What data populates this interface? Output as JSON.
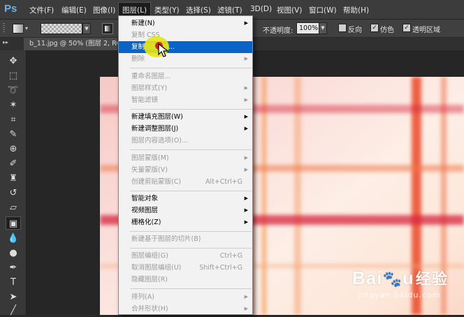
{
  "app": {
    "logo": "Ps"
  },
  "menubar": [
    {
      "label": "文件(F)"
    },
    {
      "label": "编辑(E)"
    },
    {
      "label": "图像(I)"
    },
    {
      "label": "图层(L)"
    },
    {
      "label": "类型(Y)"
    },
    {
      "label": "选择(S)"
    },
    {
      "label": "滤镜(T)"
    },
    {
      "label": "3D(D)"
    },
    {
      "label": "视图(V)"
    },
    {
      "label": "窗口(W)"
    },
    {
      "label": "帮助(H)"
    }
  ],
  "options": {
    "opacity_label": "不透明度:",
    "opacity_value": "100%",
    "reverse_label": "反向",
    "dither_label": "仿色",
    "transparency_label": "透明区域",
    "check_mark": "✓"
  },
  "document": {
    "tab_title": "b_11.jpg @ 50% (图层 2, RGB/8)"
  },
  "layer_menu": {
    "items": [
      {
        "label": "新建(N)",
        "shortcut": "",
        "submenu": true,
        "enabled": true,
        "highlighted": false
      },
      {
        "label": "复制 CSS",
        "shortcut": "",
        "submenu": false,
        "enabled": false,
        "highlighted": false
      },
      {
        "label": "复制图层(D)...",
        "shortcut": "",
        "submenu": false,
        "enabled": true,
        "highlighted": true
      },
      {
        "label": "删除",
        "shortcut": "",
        "submenu": true,
        "enabled": false,
        "highlighted": false
      },
      {
        "label": "重命名图层...",
        "shortcut": "",
        "submenu": false,
        "enabled": false,
        "highlighted": false
      },
      {
        "label": "图层样式(Y)",
        "shortcut": "",
        "submenu": true,
        "enabled": false,
        "highlighted": false
      },
      {
        "label": "智能滤镜",
        "shortcut": "",
        "submenu": true,
        "enabled": false,
        "highlighted": false
      },
      {
        "label": "新建填充图层(W)",
        "shortcut": "",
        "submenu": true,
        "enabled": true,
        "highlighted": false
      },
      {
        "label": "新建调整图层(J)",
        "shortcut": "",
        "submenu": true,
        "enabled": true,
        "highlighted": false
      },
      {
        "label": "图层内容选项(O)...",
        "shortcut": "",
        "submenu": false,
        "enabled": false,
        "highlighted": false
      },
      {
        "label": "图层蒙版(M)",
        "shortcut": "",
        "submenu": true,
        "enabled": false,
        "highlighted": false
      },
      {
        "label": "矢量蒙版(V)",
        "shortcut": "",
        "submenu": true,
        "enabled": false,
        "highlighted": false
      },
      {
        "label": "创建剪贴蒙版(C)",
        "shortcut": "Alt+Ctrl+G",
        "submenu": false,
        "enabled": false,
        "highlighted": false
      },
      {
        "label": "智能对象",
        "shortcut": "",
        "submenu": true,
        "enabled": true,
        "highlighted": false
      },
      {
        "label": "视频图层",
        "shortcut": "",
        "submenu": true,
        "enabled": true,
        "highlighted": false
      },
      {
        "label": "栅格化(Z)",
        "shortcut": "",
        "submenu": true,
        "enabled": true,
        "highlighted": false
      },
      {
        "label": "新建基于图层的切片(B)",
        "shortcut": "",
        "submenu": false,
        "enabled": false,
        "highlighted": false
      },
      {
        "label": "图层编组(G)",
        "shortcut": "Ctrl+G",
        "submenu": false,
        "enabled": false,
        "highlighted": false
      },
      {
        "label": "取消图层编组(U)",
        "shortcut": "Shift+Ctrl+G",
        "submenu": false,
        "enabled": false,
        "highlighted": false
      },
      {
        "label": "隐藏图层(R)",
        "shortcut": "",
        "submenu": false,
        "enabled": false,
        "highlighted": false
      },
      {
        "label": "排列(A)",
        "shortcut": "",
        "submenu": true,
        "enabled": false,
        "highlighted": false
      },
      {
        "label": "合并形状(H)",
        "shortcut": "",
        "submenu": true,
        "enabled": false,
        "highlighted": false
      }
    ]
  },
  "toolbar_icons": [
    "move-tool-icon",
    "rectangular-marquee-icon",
    "lasso-icon",
    "magic-wand-icon",
    "crop-icon",
    "eyedropper-icon",
    "spot-healing-brush-icon",
    "brush-icon",
    "clone-stamp-icon",
    "history-brush-icon",
    "eraser-icon",
    "gradient-tool-icon",
    "blur-icon",
    "dodge-icon",
    "pen-icon",
    "type-icon",
    "path-selection-icon",
    "line-tool-icon"
  ],
  "watermark": {
    "brand": "Bai",
    "brand_end": "u",
    "cn_text": "经验",
    "url": "jingyan.baidu.com"
  },
  "colors": {
    "menu_highlight": "#0a64c8",
    "ps_logo": "#6fb2e6",
    "stripe_orange": "#f15a24",
    "stripe_red": "#d7263d",
    "cursor_halo": "#e6e614",
    "cursor_dot": "#e02020"
  }
}
